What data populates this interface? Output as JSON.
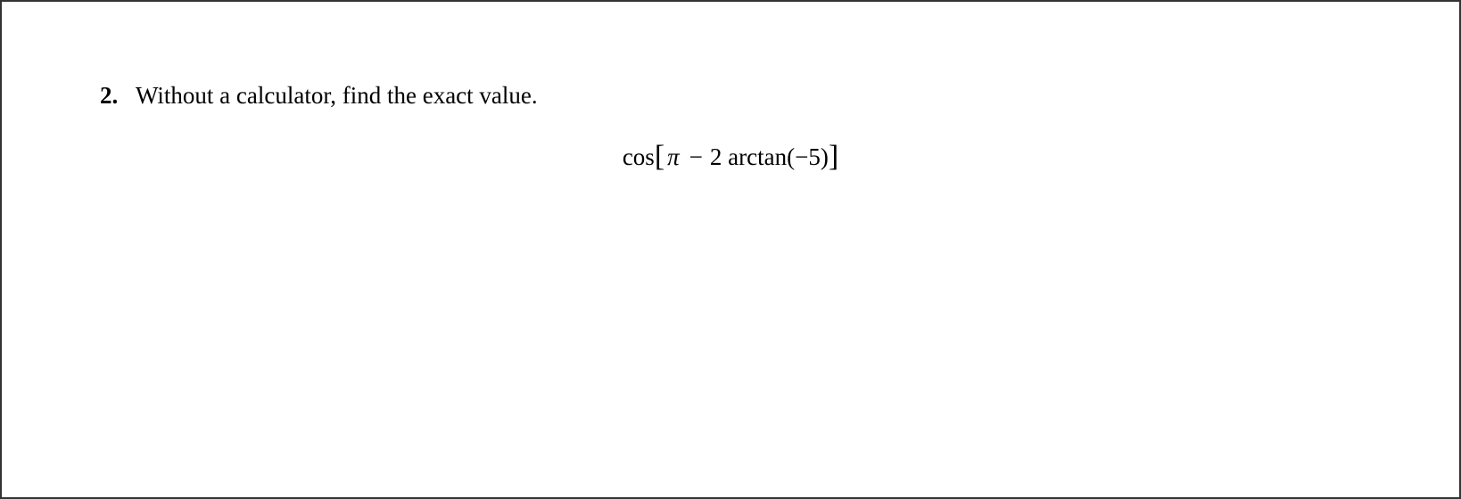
{
  "problem": {
    "number": "2.",
    "instruction": "Without a calculator, find the exact value."
  },
  "formula": {
    "cos": "cos",
    "lbracket": "[",
    "pi": "π",
    "minus": "−",
    "two": "2",
    "arctan": "arctan",
    "lparen": "(",
    "neg5": "−5",
    "rparen": ")",
    "rbracket": "]"
  }
}
